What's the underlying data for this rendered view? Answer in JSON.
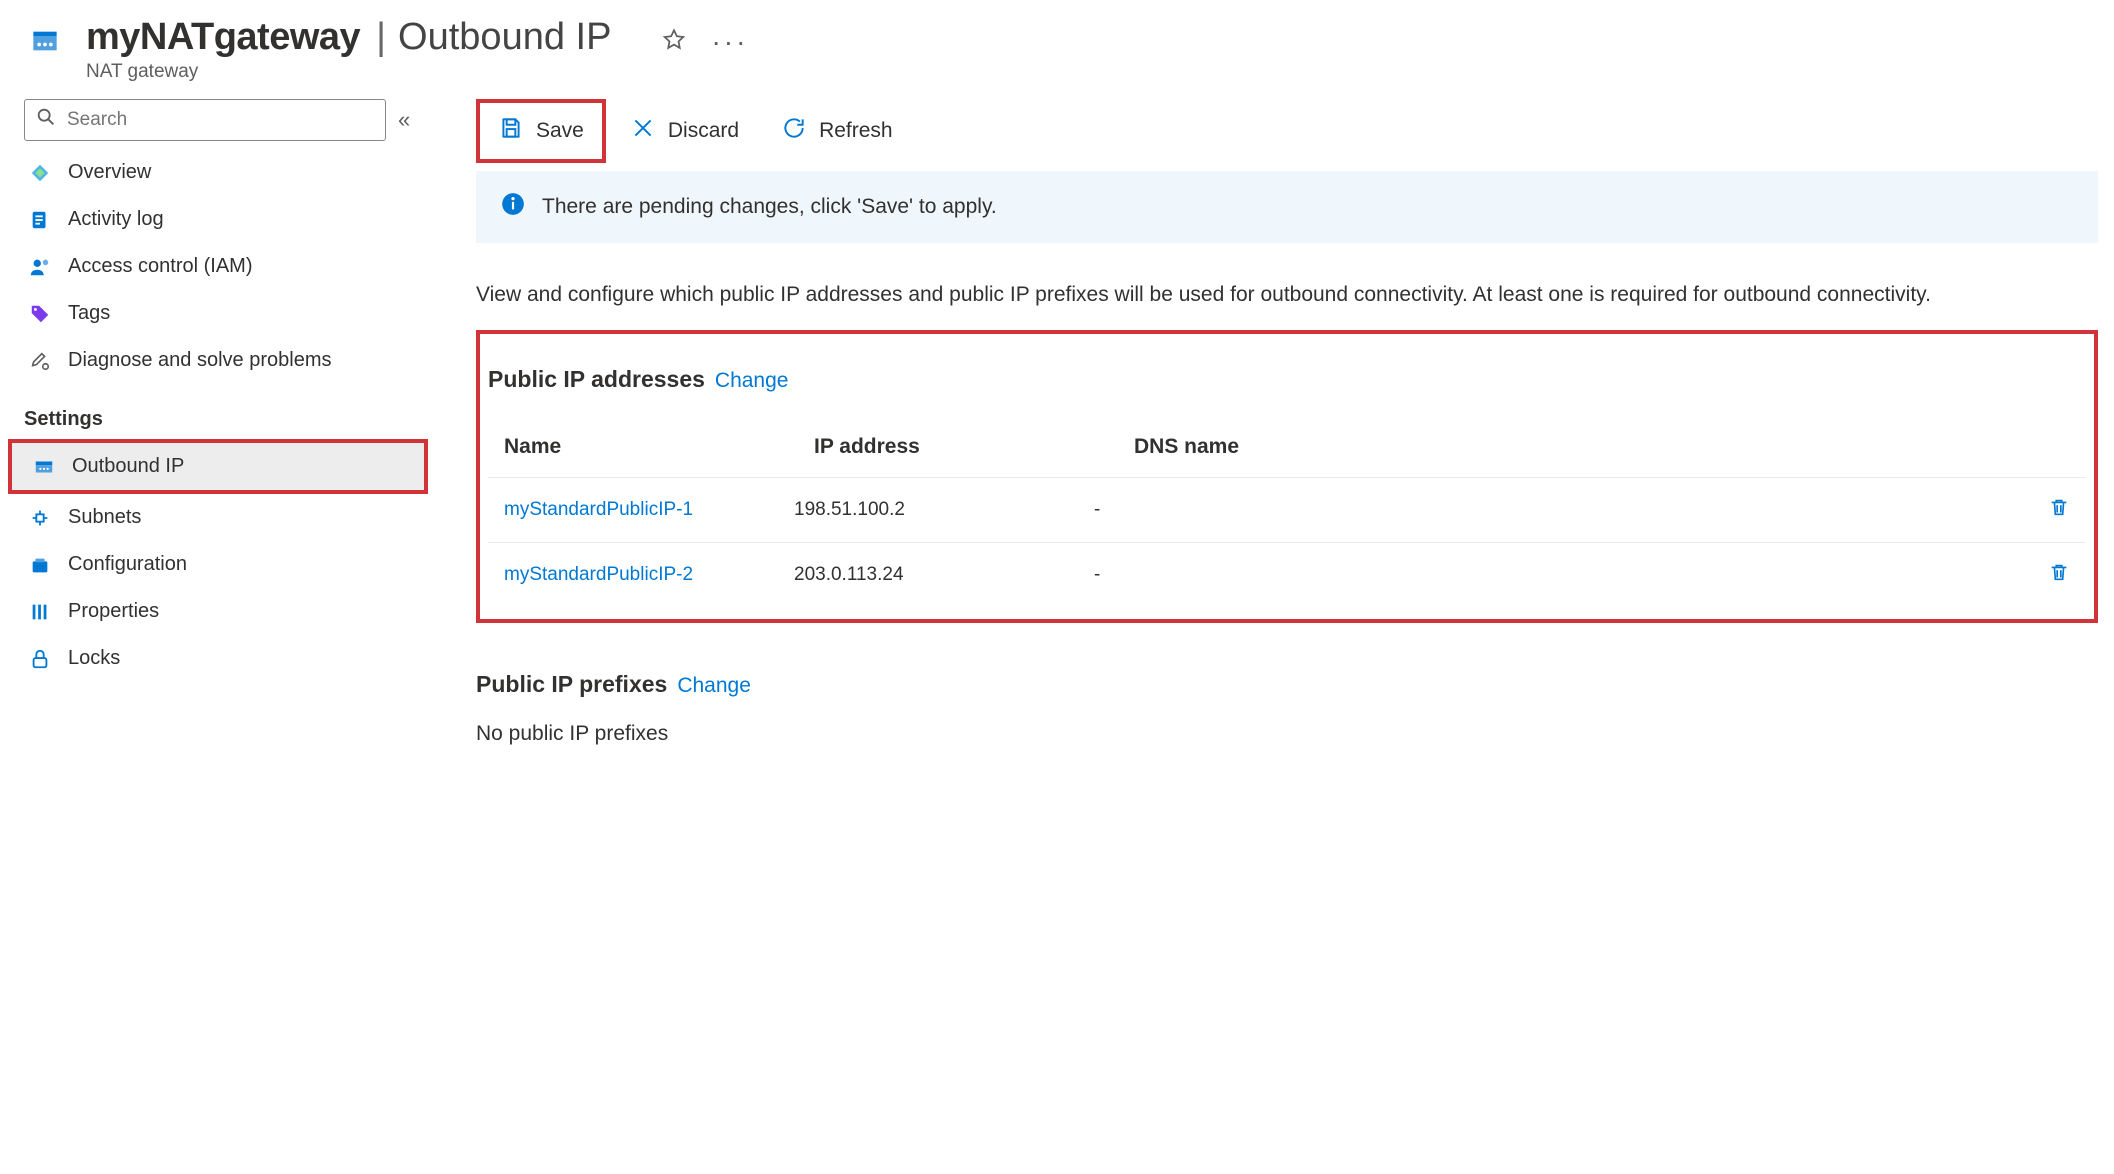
{
  "header": {
    "title_main": "myNATgateway",
    "title_page": "Outbound IP",
    "subtitle": "NAT gateway"
  },
  "sidebar": {
    "search_placeholder": "Search",
    "items_top": [
      {
        "label": "Overview"
      },
      {
        "label": "Activity log"
      },
      {
        "label": "Access control (IAM)"
      },
      {
        "label": "Tags"
      },
      {
        "label": "Diagnose and solve problems"
      }
    ],
    "settings_header": "Settings",
    "items_settings": [
      {
        "label": "Outbound IP",
        "selected": true
      },
      {
        "label": "Subnets"
      },
      {
        "label": "Configuration"
      },
      {
        "label": "Properties"
      },
      {
        "label": "Locks"
      }
    ]
  },
  "toolbar": {
    "save": "Save",
    "discard": "Discard",
    "refresh": "Refresh"
  },
  "banner": {
    "text": "There are pending changes, click 'Save' to apply."
  },
  "description": "View and configure which public IP addresses and public IP prefixes will be used for outbound connectivity. At least one is required for outbound connectivity.",
  "public_ip": {
    "title": "Public IP addresses",
    "change": "Change",
    "columns": {
      "name": "Name",
      "ip": "IP address",
      "dns": "DNS name"
    },
    "rows": [
      {
        "name": "myStandardPublicIP-1",
        "ip": "198.51.100.2",
        "dns": "-"
      },
      {
        "name": "myStandardPublicIP-2",
        "ip": "203.0.113.24",
        "dns": "-"
      }
    ]
  },
  "public_ip_prefixes": {
    "title": "Public IP prefixes",
    "change": "Change",
    "empty": "No public IP prefixes"
  }
}
